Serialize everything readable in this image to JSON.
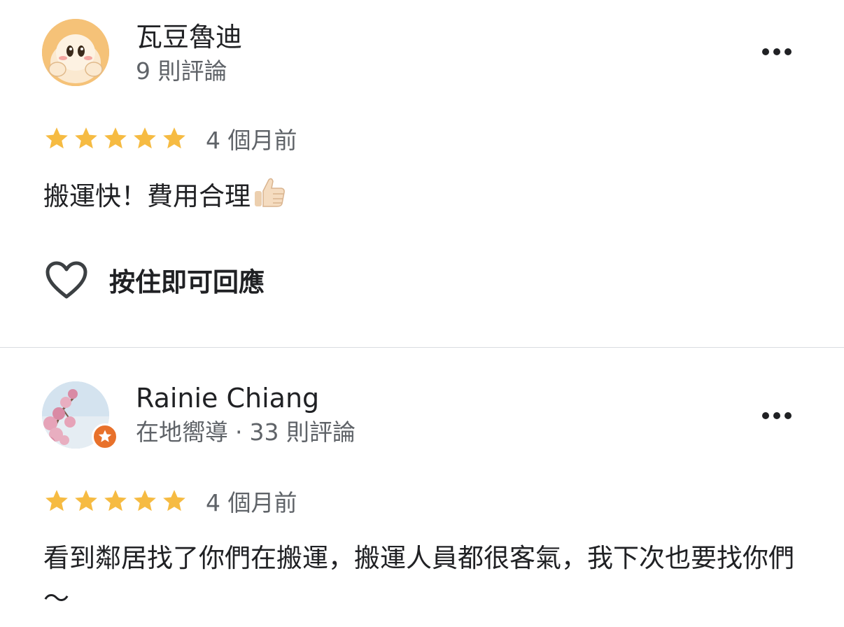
{
  "colors": {
    "star": "#f6bb42",
    "text_primary": "#202124",
    "text_secondary": "#5f6368",
    "divider": "#dadce0",
    "local_guide_badge": "#e8712b"
  },
  "reviews": [
    {
      "author": "瓦豆魯迪",
      "meta": "9 則評論",
      "avatar_icon": "cartoon-avatar",
      "rating": 5,
      "time": "4 個月前",
      "text": "搬運快！費用合理",
      "text_emoji": "thumbs-up-icon",
      "like_label": "按住即可回應",
      "more_icon": "more-options-icon"
    },
    {
      "author": "Rainie Chiang",
      "meta_badge": "在地嚮導",
      "meta_sep": "·",
      "meta": "33 則評論",
      "avatar_icon": "cherry-blossom-photo",
      "badge_icon": "local-guide-star-icon",
      "rating": 5,
      "time": "4 個月前",
      "text": "看到鄰居找了你們在搬運，搬運人員都很客氣，我下次也要找你們～",
      "more_icon": "more-options-icon"
    }
  ]
}
